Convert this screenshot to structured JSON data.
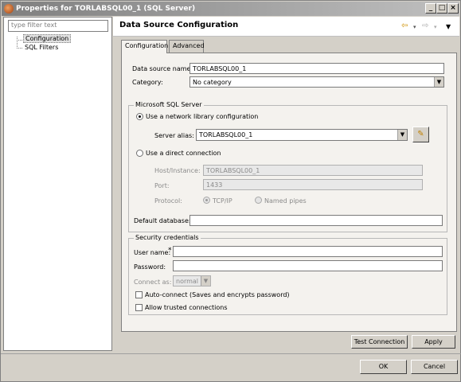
{
  "window": {
    "title": "Properties for TORLABSQL00_1 (SQL Server)"
  },
  "left": {
    "filter_placeholder": "type filter text",
    "tree": [
      "Configuration",
      "SQL Filters"
    ]
  },
  "page": {
    "title": "Data Source Configuration",
    "tabs": [
      "Configuration",
      "Advanced"
    ]
  },
  "form": {
    "data_source_name_label": "Data source name:",
    "data_source_name_value": "TORLABSQL00_1",
    "category_label": "Category:",
    "category_value": "No category",
    "mssql_group": "Microsoft SQL Server",
    "use_network_label": "Use a network library configuration",
    "server_alias_label": "Server alias:",
    "server_alias_value": "TORLABSQL00_1",
    "use_direct_label": "Use a direct connection",
    "host_label": "Host/Instance:",
    "host_value": "TORLABSQL00_1",
    "port_label": "Port:",
    "port_value": "1433",
    "protocol_label": "Protocol:",
    "tcpip_label": "TCP/IP",
    "named_pipes_label": "Named pipes",
    "default_db_label": "Default database:",
    "default_db_value": "",
    "security_group": "Security credentials",
    "username_label": "User name:",
    "required_mark": "*",
    "username_value": "",
    "password_label": "Password:",
    "password_value": "",
    "connect_as_label": "Connect as:",
    "connect_as_value": "normal",
    "autoconnect_label": "Auto-connect (Saves and encrypts password)",
    "trusted_label": "Allow trusted connections"
  },
  "buttons": {
    "test_connection": "Test Connection",
    "apply": "Apply",
    "ok": "OK",
    "cancel": "Cancel"
  }
}
